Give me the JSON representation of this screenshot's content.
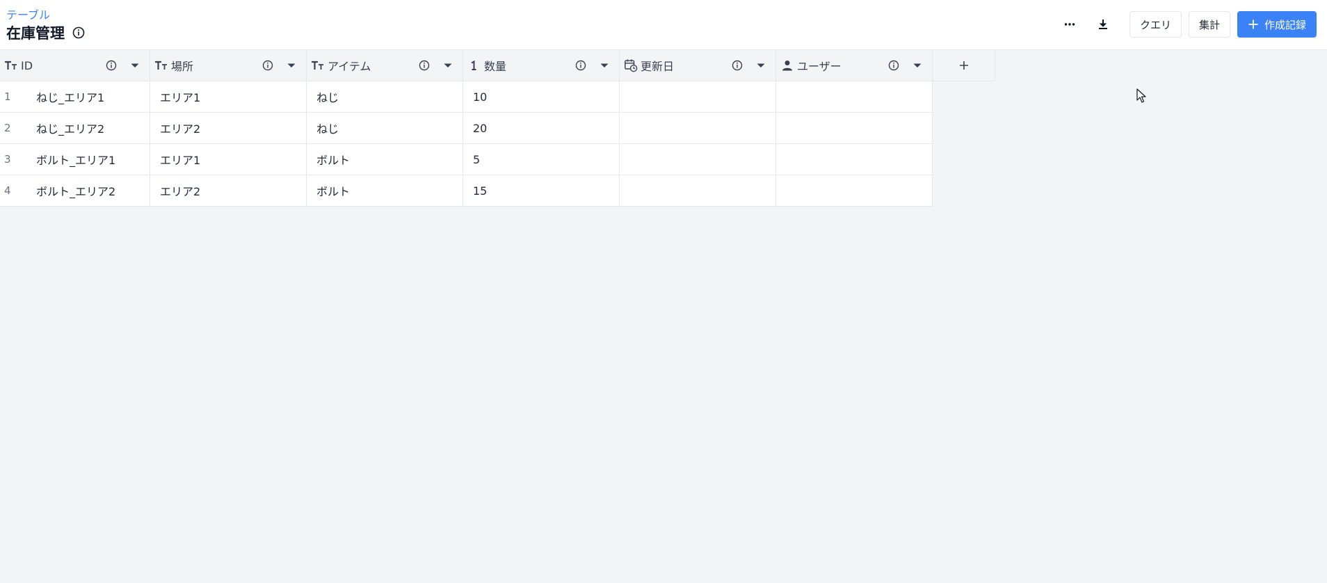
{
  "header": {
    "breadcrumb": "テーブル",
    "title": "在庫管理"
  },
  "toolbar": {
    "query_label": "クエリ",
    "aggregate_label": "集計",
    "create_label": "作成記録"
  },
  "colors": {
    "accent": "#3b82f6",
    "border": "#e5e7eb",
    "background": "#f3f4f6"
  },
  "table": {
    "columns": [
      {
        "label": "ID",
        "icon": "text-type-icon"
      },
      {
        "label": "場所",
        "icon": "text-type-icon"
      },
      {
        "label": "アイテム",
        "icon": "text-type-icon"
      },
      {
        "label": "数量",
        "icon": "number-type-icon"
      },
      {
        "label": "更新日",
        "icon": "calendar-clock-icon"
      },
      {
        "label": "ユーザー",
        "icon": "user-icon"
      }
    ],
    "add_column_label": "+",
    "rows": [
      {
        "num": "1",
        "id": "ねじ_エリア1",
        "location": "エリア1",
        "item": "ねじ",
        "qty": "10",
        "updated": "",
        "user": ""
      },
      {
        "num": "2",
        "id": "ねじ_エリア2",
        "location": "エリア2",
        "item": "ねじ",
        "qty": "20",
        "updated": "",
        "user": ""
      },
      {
        "num": "3",
        "id": "ボルト_エリア1",
        "location": "エリア1",
        "item": "ボルト",
        "qty": "5",
        "updated": "",
        "user": ""
      },
      {
        "num": "4",
        "id": "ボルト_エリア2",
        "location": "エリア2",
        "item": "ボルト",
        "qty": "15",
        "updated": "",
        "user": ""
      }
    ]
  }
}
